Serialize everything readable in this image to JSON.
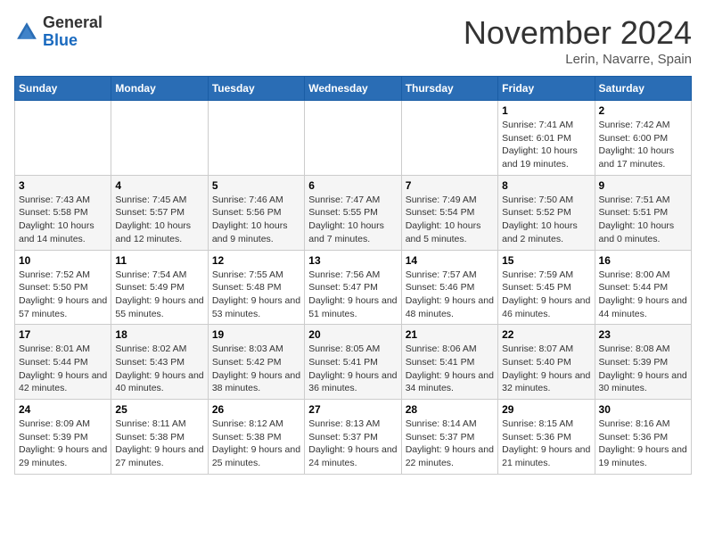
{
  "header": {
    "logo_general": "General",
    "logo_blue": "Blue",
    "month_title": "November 2024",
    "location": "Lerin, Navarre, Spain"
  },
  "weekdays": [
    "Sunday",
    "Monday",
    "Tuesday",
    "Wednesday",
    "Thursday",
    "Friday",
    "Saturday"
  ],
  "weeks": [
    [
      {
        "day": "",
        "info": ""
      },
      {
        "day": "",
        "info": ""
      },
      {
        "day": "",
        "info": ""
      },
      {
        "day": "",
        "info": ""
      },
      {
        "day": "",
        "info": ""
      },
      {
        "day": "1",
        "info": "Sunrise: 7:41 AM\nSunset: 6:01 PM\nDaylight: 10 hours and 19 minutes."
      },
      {
        "day": "2",
        "info": "Sunrise: 7:42 AM\nSunset: 6:00 PM\nDaylight: 10 hours and 17 minutes."
      }
    ],
    [
      {
        "day": "3",
        "info": "Sunrise: 7:43 AM\nSunset: 5:58 PM\nDaylight: 10 hours and 14 minutes."
      },
      {
        "day": "4",
        "info": "Sunrise: 7:45 AM\nSunset: 5:57 PM\nDaylight: 10 hours and 12 minutes."
      },
      {
        "day": "5",
        "info": "Sunrise: 7:46 AM\nSunset: 5:56 PM\nDaylight: 10 hours and 9 minutes."
      },
      {
        "day": "6",
        "info": "Sunrise: 7:47 AM\nSunset: 5:55 PM\nDaylight: 10 hours and 7 minutes."
      },
      {
        "day": "7",
        "info": "Sunrise: 7:49 AM\nSunset: 5:54 PM\nDaylight: 10 hours and 5 minutes."
      },
      {
        "day": "8",
        "info": "Sunrise: 7:50 AM\nSunset: 5:52 PM\nDaylight: 10 hours and 2 minutes."
      },
      {
        "day": "9",
        "info": "Sunrise: 7:51 AM\nSunset: 5:51 PM\nDaylight: 10 hours and 0 minutes."
      }
    ],
    [
      {
        "day": "10",
        "info": "Sunrise: 7:52 AM\nSunset: 5:50 PM\nDaylight: 9 hours and 57 minutes."
      },
      {
        "day": "11",
        "info": "Sunrise: 7:54 AM\nSunset: 5:49 PM\nDaylight: 9 hours and 55 minutes."
      },
      {
        "day": "12",
        "info": "Sunrise: 7:55 AM\nSunset: 5:48 PM\nDaylight: 9 hours and 53 minutes."
      },
      {
        "day": "13",
        "info": "Sunrise: 7:56 AM\nSunset: 5:47 PM\nDaylight: 9 hours and 51 minutes."
      },
      {
        "day": "14",
        "info": "Sunrise: 7:57 AM\nSunset: 5:46 PM\nDaylight: 9 hours and 48 minutes."
      },
      {
        "day": "15",
        "info": "Sunrise: 7:59 AM\nSunset: 5:45 PM\nDaylight: 9 hours and 46 minutes."
      },
      {
        "day": "16",
        "info": "Sunrise: 8:00 AM\nSunset: 5:44 PM\nDaylight: 9 hours and 44 minutes."
      }
    ],
    [
      {
        "day": "17",
        "info": "Sunrise: 8:01 AM\nSunset: 5:44 PM\nDaylight: 9 hours and 42 minutes."
      },
      {
        "day": "18",
        "info": "Sunrise: 8:02 AM\nSunset: 5:43 PM\nDaylight: 9 hours and 40 minutes."
      },
      {
        "day": "19",
        "info": "Sunrise: 8:03 AM\nSunset: 5:42 PM\nDaylight: 9 hours and 38 minutes."
      },
      {
        "day": "20",
        "info": "Sunrise: 8:05 AM\nSunset: 5:41 PM\nDaylight: 9 hours and 36 minutes."
      },
      {
        "day": "21",
        "info": "Sunrise: 8:06 AM\nSunset: 5:41 PM\nDaylight: 9 hours and 34 minutes."
      },
      {
        "day": "22",
        "info": "Sunrise: 8:07 AM\nSunset: 5:40 PM\nDaylight: 9 hours and 32 minutes."
      },
      {
        "day": "23",
        "info": "Sunrise: 8:08 AM\nSunset: 5:39 PM\nDaylight: 9 hours and 30 minutes."
      }
    ],
    [
      {
        "day": "24",
        "info": "Sunrise: 8:09 AM\nSunset: 5:39 PM\nDaylight: 9 hours and 29 minutes."
      },
      {
        "day": "25",
        "info": "Sunrise: 8:11 AM\nSunset: 5:38 PM\nDaylight: 9 hours and 27 minutes."
      },
      {
        "day": "26",
        "info": "Sunrise: 8:12 AM\nSunset: 5:38 PM\nDaylight: 9 hours and 25 minutes."
      },
      {
        "day": "27",
        "info": "Sunrise: 8:13 AM\nSunset: 5:37 PM\nDaylight: 9 hours and 24 minutes."
      },
      {
        "day": "28",
        "info": "Sunrise: 8:14 AM\nSunset: 5:37 PM\nDaylight: 9 hours and 22 minutes."
      },
      {
        "day": "29",
        "info": "Sunrise: 8:15 AM\nSunset: 5:36 PM\nDaylight: 9 hours and 21 minutes."
      },
      {
        "day": "30",
        "info": "Sunrise: 8:16 AM\nSunset: 5:36 PM\nDaylight: 9 hours and 19 minutes."
      }
    ]
  ]
}
